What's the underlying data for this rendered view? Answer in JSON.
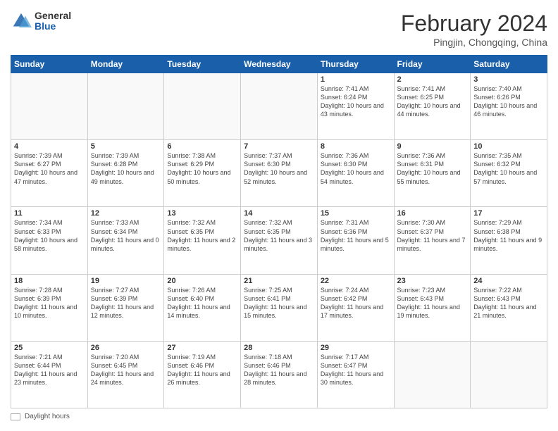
{
  "logo": {
    "general": "General",
    "blue": "Blue"
  },
  "title": "February 2024",
  "location": "Pingjin, Chongqing, China",
  "headers": [
    "Sunday",
    "Monday",
    "Tuesday",
    "Wednesday",
    "Thursday",
    "Friday",
    "Saturday"
  ],
  "weeks": [
    [
      {
        "day": "",
        "info": ""
      },
      {
        "day": "",
        "info": ""
      },
      {
        "day": "",
        "info": ""
      },
      {
        "day": "",
        "info": ""
      },
      {
        "day": "1",
        "info": "Sunrise: 7:41 AM\nSunset: 6:24 PM\nDaylight: 10 hours and 43 minutes."
      },
      {
        "day": "2",
        "info": "Sunrise: 7:41 AM\nSunset: 6:25 PM\nDaylight: 10 hours and 44 minutes."
      },
      {
        "day": "3",
        "info": "Sunrise: 7:40 AM\nSunset: 6:26 PM\nDaylight: 10 hours and 46 minutes."
      }
    ],
    [
      {
        "day": "4",
        "info": "Sunrise: 7:39 AM\nSunset: 6:27 PM\nDaylight: 10 hours and 47 minutes."
      },
      {
        "day": "5",
        "info": "Sunrise: 7:39 AM\nSunset: 6:28 PM\nDaylight: 10 hours and 49 minutes."
      },
      {
        "day": "6",
        "info": "Sunrise: 7:38 AM\nSunset: 6:29 PM\nDaylight: 10 hours and 50 minutes."
      },
      {
        "day": "7",
        "info": "Sunrise: 7:37 AM\nSunset: 6:30 PM\nDaylight: 10 hours and 52 minutes."
      },
      {
        "day": "8",
        "info": "Sunrise: 7:36 AM\nSunset: 6:30 PM\nDaylight: 10 hours and 54 minutes."
      },
      {
        "day": "9",
        "info": "Sunrise: 7:36 AM\nSunset: 6:31 PM\nDaylight: 10 hours and 55 minutes."
      },
      {
        "day": "10",
        "info": "Sunrise: 7:35 AM\nSunset: 6:32 PM\nDaylight: 10 hours and 57 minutes."
      }
    ],
    [
      {
        "day": "11",
        "info": "Sunrise: 7:34 AM\nSunset: 6:33 PM\nDaylight: 10 hours and 58 minutes."
      },
      {
        "day": "12",
        "info": "Sunrise: 7:33 AM\nSunset: 6:34 PM\nDaylight: 11 hours and 0 minutes."
      },
      {
        "day": "13",
        "info": "Sunrise: 7:32 AM\nSunset: 6:35 PM\nDaylight: 11 hours and 2 minutes."
      },
      {
        "day": "14",
        "info": "Sunrise: 7:32 AM\nSunset: 6:35 PM\nDaylight: 11 hours and 3 minutes."
      },
      {
        "day": "15",
        "info": "Sunrise: 7:31 AM\nSunset: 6:36 PM\nDaylight: 11 hours and 5 minutes."
      },
      {
        "day": "16",
        "info": "Sunrise: 7:30 AM\nSunset: 6:37 PM\nDaylight: 11 hours and 7 minutes."
      },
      {
        "day": "17",
        "info": "Sunrise: 7:29 AM\nSunset: 6:38 PM\nDaylight: 11 hours and 9 minutes."
      }
    ],
    [
      {
        "day": "18",
        "info": "Sunrise: 7:28 AM\nSunset: 6:39 PM\nDaylight: 11 hours and 10 minutes."
      },
      {
        "day": "19",
        "info": "Sunrise: 7:27 AM\nSunset: 6:39 PM\nDaylight: 11 hours and 12 minutes."
      },
      {
        "day": "20",
        "info": "Sunrise: 7:26 AM\nSunset: 6:40 PM\nDaylight: 11 hours and 14 minutes."
      },
      {
        "day": "21",
        "info": "Sunrise: 7:25 AM\nSunset: 6:41 PM\nDaylight: 11 hours and 15 minutes."
      },
      {
        "day": "22",
        "info": "Sunrise: 7:24 AM\nSunset: 6:42 PM\nDaylight: 11 hours and 17 minutes."
      },
      {
        "day": "23",
        "info": "Sunrise: 7:23 AM\nSunset: 6:43 PM\nDaylight: 11 hours and 19 minutes."
      },
      {
        "day": "24",
        "info": "Sunrise: 7:22 AM\nSunset: 6:43 PM\nDaylight: 11 hours and 21 minutes."
      }
    ],
    [
      {
        "day": "25",
        "info": "Sunrise: 7:21 AM\nSunset: 6:44 PM\nDaylight: 11 hours and 23 minutes."
      },
      {
        "day": "26",
        "info": "Sunrise: 7:20 AM\nSunset: 6:45 PM\nDaylight: 11 hours and 24 minutes."
      },
      {
        "day": "27",
        "info": "Sunrise: 7:19 AM\nSunset: 6:46 PM\nDaylight: 11 hours and 26 minutes."
      },
      {
        "day": "28",
        "info": "Sunrise: 7:18 AM\nSunset: 6:46 PM\nDaylight: 11 hours and 28 minutes."
      },
      {
        "day": "29",
        "info": "Sunrise: 7:17 AM\nSunset: 6:47 PM\nDaylight: 11 hours and 30 minutes."
      },
      {
        "day": "",
        "info": ""
      },
      {
        "day": "",
        "info": ""
      }
    ]
  ],
  "legend": {
    "label": "Daylight hours"
  }
}
